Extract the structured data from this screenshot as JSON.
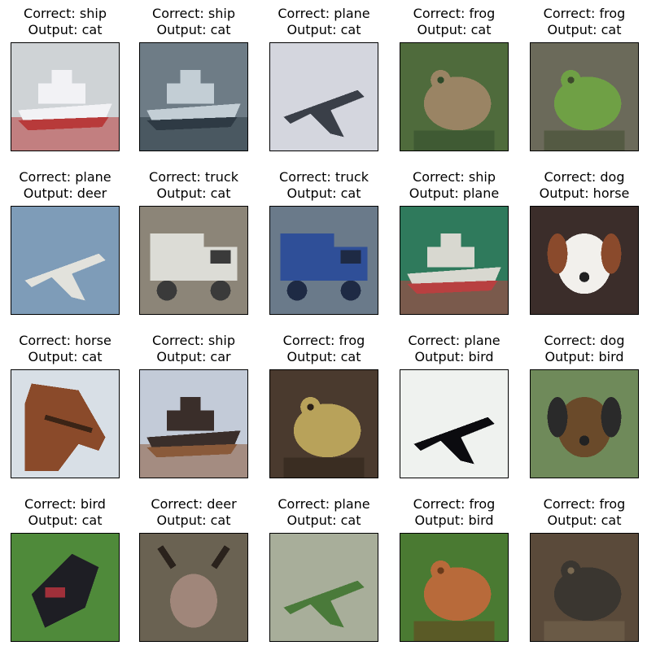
{
  "cells": [
    {
      "correct": "Correct: ship",
      "output": "Output: cat",
      "subject": "ship",
      "image_icon": "ship-icon",
      "bg": "#cfd3d6",
      "fg": "#f2f2f5",
      "accent": "#b83a3a"
    },
    {
      "correct": "Correct: ship",
      "output": "Output: cat",
      "subject": "ship",
      "image_icon": "ship-icon",
      "bg": "#6e7c86",
      "fg": "#c3ced5",
      "accent": "#2e3a44"
    },
    {
      "correct": "Correct: plane",
      "output": "Output: cat",
      "subject": "plane",
      "image_icon": "plane-icon",
      "bg": "#d4d6de",
      "fg": "#3a3f48",
      "accent": "#b4424a"
    },
    {
      "correct": "Correct: frog",
      "output": "Output: cat",
      "subject": "frog",
      "image_icon": "frog-icon",
      "bg": "#4f6b3c",
      "fg": "#9a8464",
      "accent": "#2f4a2a"
    },
    {
      "correct": "Correct: frog",
      "output": "Output: cat",
      "subject": "frog",
      "image_icon": "frog-icon",
      "bg": "#6b6a5a",
      "fg": "#6fa045",
      "accent": "#3d4a2c"
    },
    {
      "correct": "Correct: plane",
      "output": "Output: deer",
      "subject": "plane",
      "image_icon": "plane-icon",
      "bg": "#7e9cb8",
      "fg": "#e2e2dc",
      "accent": "#5b6b7a"
    },
    {
      "correct": "Correct: truck",
      "output": "Output: cat",
      "subject": "truck",
      "image_icon": "truck-icon",
      "bg": "#8c8578",
      "fg": "#dcdcd6",
      "accent": "#3a3a3a"
    },
    {
      "correct": "Correct: truck",
      "output": "Output: cat",
      "subject": "truck",
      "image_icon": "truck-icon",
      "bg": "#6a7a8a",
      "fg": "#2f4f98",
      "accent": "#1e2a44"
    },
    {
      "correct": "Correct: ship",
      "output": "Output: plane",
      "subject": "ship",
      "image_icon": "ship-icon",
      "bg": "#2f7a5c",
      "fg": "#d8d8d0",
      "accent": "#b84040"
    },
    {
      "correct": "Correct: dog",
      "output": "Output: horse",
      "subject": "dog",
      "image_icon": "dog-icon",
      "bg": "#3b2d2a",
      "fg": "#f2f0ec",
      "accent": "#8a4a2c"
    },
    {
      "correct": "Correct: horse",
      "output": "Output: cat",
      "subject": "horse",
      "image_icon": "horse-icon",
      "bg": "#d8dfe6",
      "fg": "#8a4a2a",
      "accent": "#3b2416"
    },
    {
      "correct": "Correct: ship",
      "output": "Output: car",
      "subject": "ship",
      "image_icon": "ship-icon",
      "bg": "#c3cbd8",
      "fg": "#3a2e2a",
      "accent": "#8a5a3a"
    },
    {
      "correct": "Correct: frog",
      "output": "Output: cat",
      "subject": "frog",
      "image_icon": "frog-icon",
      "bg": "#4a3a2e",
      "fg": "#b8a25a",
      "accent": "#2a2016"
    },
    {
      "correct": "Correct: plane",
      "output": "Output: bird",
      "subject": "plane",
      "image_icon": "plane-icon",
      "bg": "#eff2ef",
      "fg": "#0b0b0f",
      "accent": "#0b0b0f"
    },
    {
      "correct": "Correct: dog",
      "output": "Output: bird",
      "subject": "dog",
      "image_icon": "dog-icon",
      "bg": "#6f8a5a",
      "fg": "#6a4a2a",
      "accent": "#2a2a2a"
    },
    {
      "correct": "Correct: bird",
      "output": "Output: cat",
      "subject": "bird",
      "image_icon": "bird-icon",
      "bg": "#4f8a3a",
      "fg": "#1e1e24",
      "accent": "#a0303a"
    },
    {
      "correct": "Correct: deer",
      "output": "Output: cat",
      "subject": "deer",
      "image_icon": "deer-icon",
      "bg": "#6a6252",
      "fg": "#a0867a",
      "accent": "#2a221c"
    },
    {
      "correct": "Correct: plane",
      "output": "Output: cat",
      "subject": "plane",
      "image_icon": "plane-icon",
      "bg": "#a8ae9a",
      "fg": "#4a7a3a",
      "accent": "#2e4a2a"
    },
    {
      "correct": "Correct: frog",
      "output": "Output: bird",
      "subject": "frog",
      "image_icon": "frog-icon",
      "bg": "#4a7a32",
      "fg": "#b86a3a",
      "accent": "#6a3a1a"
    },
    {
      "correct": "Correct: frog",
      "output": "Output: cat",
      "subject": "frog",
      "image_icon": "frog-icon",
      "bg": "#5a4a3a",
      "fg": "#3a3630",
      "accent": "#7a6a52"
    }
  ]
}
